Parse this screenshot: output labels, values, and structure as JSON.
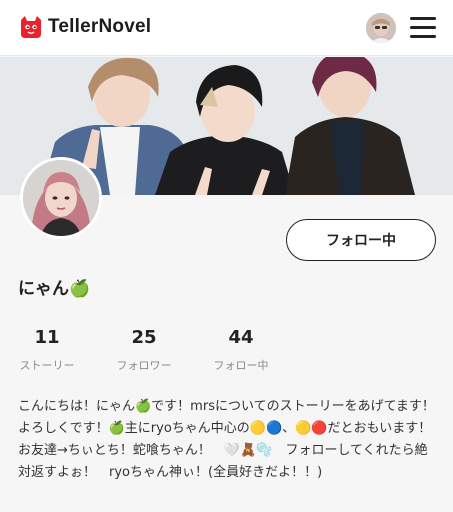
{
  "header": {
    "brand": "TellerNovel",
    "logo_icon": "cat-logo-icon",
    "menu_icon": "hamburger-menu-icon"
  },
  "profile": {
    "username": "にゃん🍏",
    "follow_label": "フォロー中",
    "stats": [
      {
        "value": "11",
        "label": "ストーリー"
      },
      {
        "value": "25",
        "label": "フォロワー"
      },
      {
        "value": "44",
        "label": "フォロー中"
      }
    ],
    "bio": "こんにちは！にゃん🍏です！mrsについてのストーリーをあげてます！よろしくです！🍏主にryoちゃん中心の🟡🔵、🟡🔴だとおもいます！お友達→ちぃとち！蛇喰ちゃん！　🤍🧸🫧　フォローしてくれたら絶対返すよぉ！　ryoちゃん神ぃ！(全員好きだよ！！)"
  },
  "colors": {
    "brand_red": "#e8242a",
    "page_bg": "#f6f6f6",
    "text_dark": "#222222",
    "text_muted": "#8a8a8a"
  }
}
